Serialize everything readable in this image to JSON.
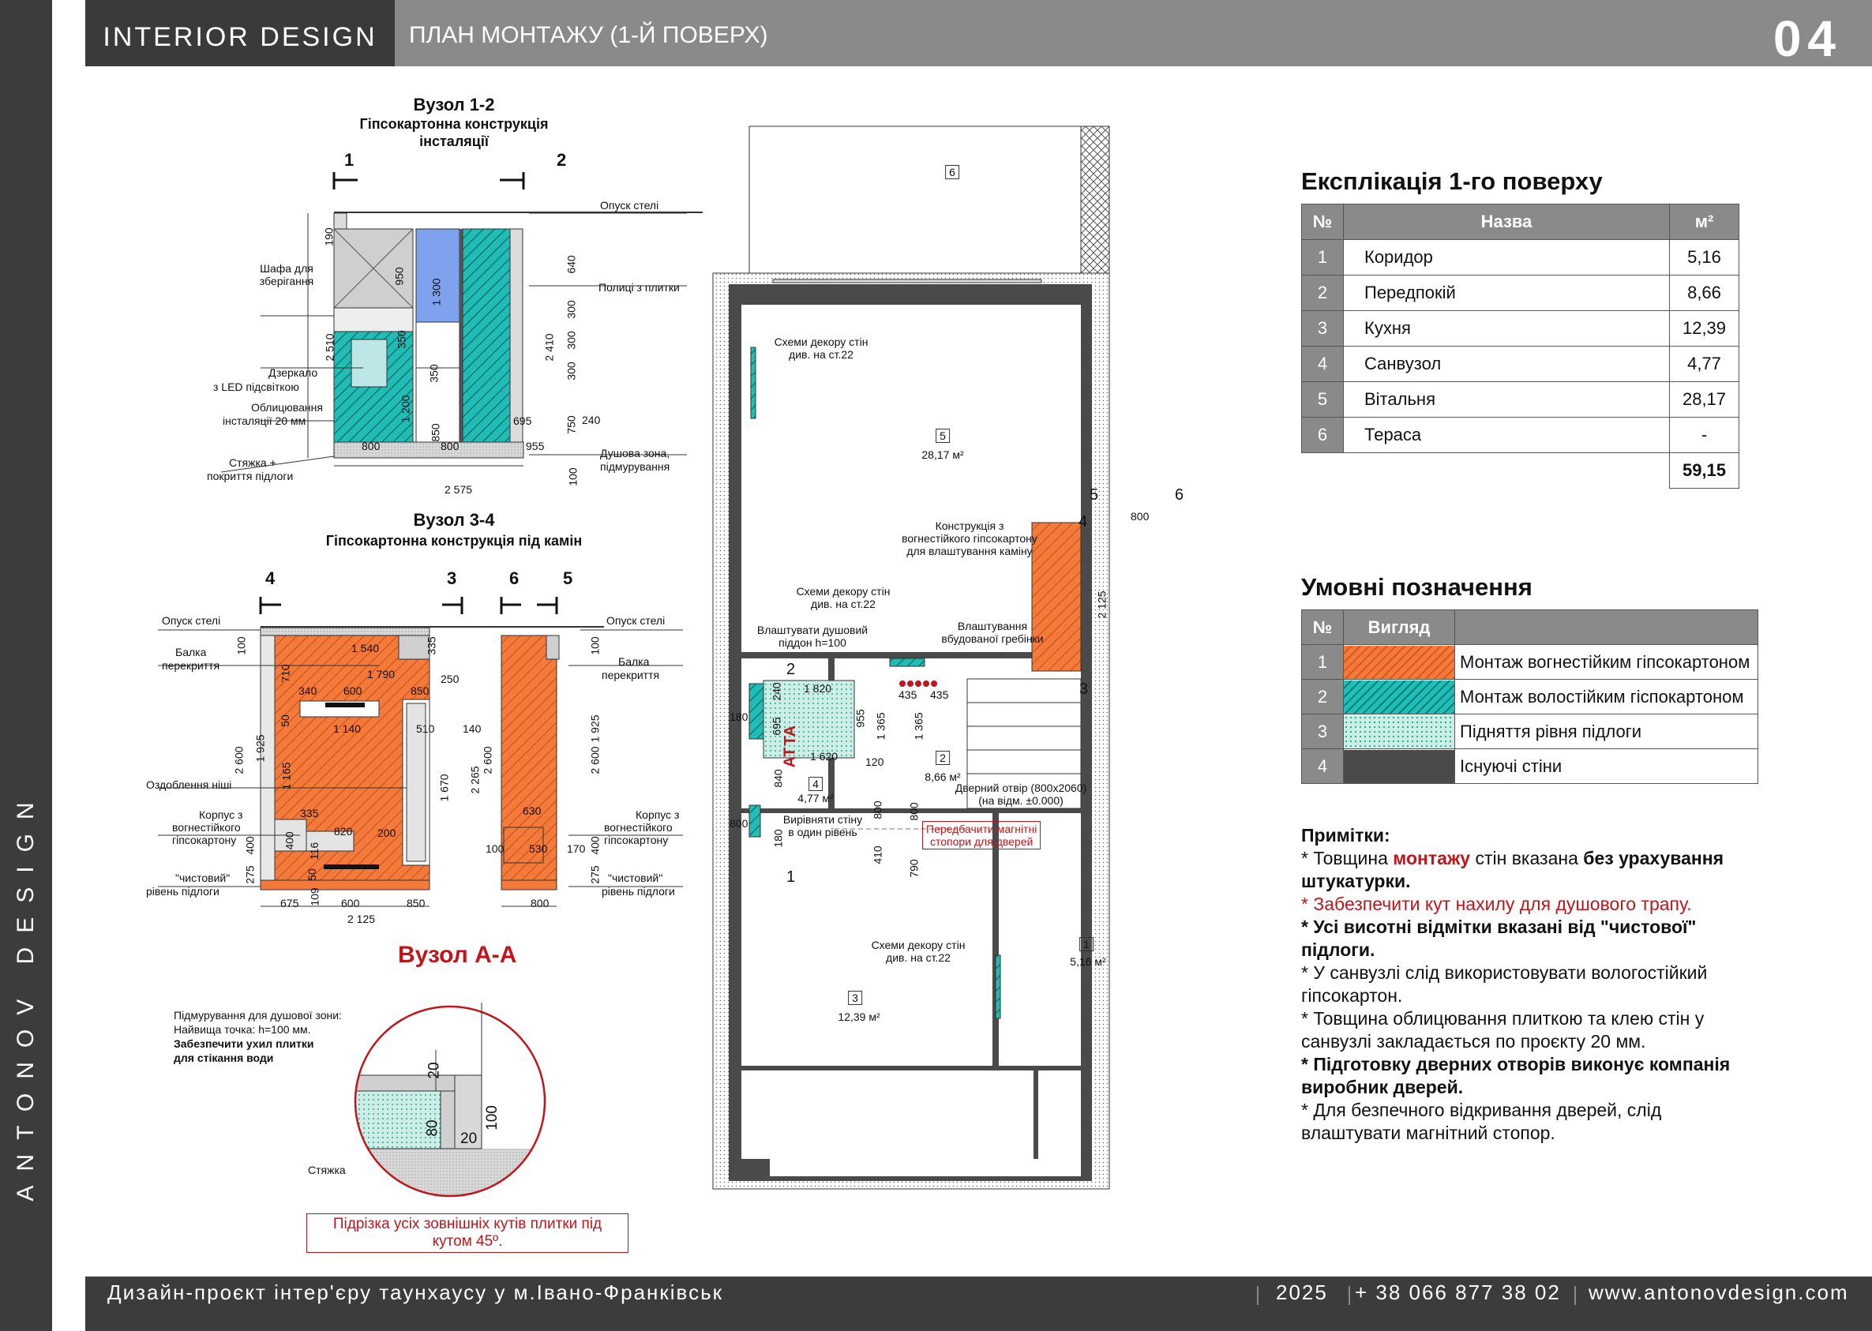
{
  "side_brand": "ANTONOV DESIGN",
  "header": {
    "brand": "INTERIOR DESIGN",
    "title": "ПЛАН МОНТАЖУ (1-Й ПОВЕРХ)",
    "page_number": "04"
  },
  "footer": {
    "project": "Дизайн-проєкт інтер'єру таунхаусу у м.Івано-Франківськ",
    "year": "2025",
    "phone": "+ 38 066 877 38 02",
    "website": "www.antonovdesign.com"
  },
  "explication": {
    "title": "Експлікація 1-го поверху",
    "headers": [
      "№",
      "Назва",
      "м²"
    ],
    "rows": [
      {
        "n": "1",
        "name": "Коридор",
        "area": "5,16"
      },
      {
        "n": "2",
        "name": "Передпокій",
        "area": "8,66"
      },
      {
        "n": "3",
        "name": "Кухня",
        "area": "12,39"
      },
      {
        "n": "4",
        "name": "Санвузол",
        "area": "4,77"
      },
      {
        "n": "5",
        "name": "Вітальня",
        "area": "28,17"
      },
      {
        "n": "6",
        "name": "Тераса",
        "area": "-"
      }
    ],
    "total": "59,15"
  },
  "legend": {
    "title": "Умовні позначення",
    "headers": [
      "№",
      "Вигляд"
    ],
    "rows": [
      {
        "n": "1",
        "label": "Монтаж вогнестійким гіпсокартоном",
        "swatch": "fire"
      },
      {
        "n": "2",
        "label": "Монтаж волостійким гіспокартоном",
        "swatch": "moist"
      },
      {
        "n": "3",
        "label": "Підняття рівня підлоги",
        "swatch": "floor"
      },
      {
        "n": "4",
        "label": "Існуючі стіни",
        "swatch": "exist"
      }
    ]
  },
  "notes": {
    "title": "Примітки:",
    "n1_a": "* Товщина ",
    "n1_b": "монтажу",
    "n1_c": " стін вказана ",
    "n1_d": "без урахування штукатурки.",
    "n2": "* Забезпечити кут нахилу для душового трапу.",
    "n3": "* Усі висотні відмітки вказані від \"чистової\" підлоги.",
    "n4": "* У санвузлі слід використовувати вологостійкий гіпсокартон.",
    "n5": "* Товщина облицювання плиткою та клею стін у санвузлі закладається по проєкту 20 мм.",
    "n6": "* Підготовку дверних отворів виконує компанія виробник дверей.",
    "n7": "* Для безпечного відкривання дверей, слід влаштувати магнітний стопор."
  },
  "node12": {
    "title": "Вузол 1-2",
    "subtitle1": "Гіпсокартонна конструкція",
    "subtitle2": "інсталяції",
    "mark1": "1",
    "mark2": "2",
    "l_cabinet": "Шафа для зберігання",
    "l_mirror1": "Дзеркало",
    "l_mirror2": "з LED підсвіткою",
    "l_cladding1": "Облицювання",
    "l_cladding2": "інсталяції 20 мм",
    "l_screed1": "Стяжка +",
    "l_screed2": "покриття підлоги",
    "r_ceiling": "Опуск стелі",
    "r_shelves": "Полиці з плитки",
    "r_shower1": "Душова зона,",
    "r_shower2": "підмурування",
    "dims": [
      "190",
      "950",
      "1 300",
      "350",
      "2 510",
      "350",
      "1 200",
      "850",
      "800",
      "800",
      "695",
      "955",
      "2 410",
      "640",
      "300",
      "300",
      "300",
      "750",
      "240",
      "100",
      "2 575"
    ]
  },
  "node34": {
    "title": "Вузол 3-4",
    "subtitle": "Гіпсокартонна конструкція під камін",
    "m4": "4",
    "m3": "3",
    "m6": "6",
    "m5": "5",
    "l_ceiling": "Опуск стелі",
    "l_beam1": "Балка",
    "l_beam2": "перекриття",
    "l_niche": "Оздоблення ніші",
    "l_body1": "Корпус з",
    "l_body2": "вогнестійкого",
    "l_body3": "гіпсокартону",
    "l_floor1": "\"чистовий\"",
    "l_floor2": "рівень підлоги",
    "dims": [
      "1 540",
      "335",
      "1 790",
      "250",
      "340",
      "600",
      "850",
      "1 140",
      "510",
      "140",
      "335",
      "820",
      "200",
      "1 670",
      "400",
      "116",
      "50",
      "109",
      "675",
      "600",
      "850",
      "2 125",
      "100",
      "710",
      "50",
      "1 165",
      "1 925",
      "2 600",
      "400",
      "275",
      "2 265",
      "2 600",
      "630",
      "530",
      "100",
      "170",
      "1 925",
      "2 600",
      "100",
      "400",
      "275",
      "800"
    ]
  },
  "nodeAA": {
    "title": "Вузол А-А",
    "t1": "Підмурування для душової зони:",
    "t2": "Найвища точка: h=100 мм.",
    "t3": "Забезпечити ухил плитки",
    "t4": "для стікання води",
    "screed": "Стяжка",
    "d20a": "20",
    "d80": "80",
    "d20b": "20",
    "d100": "100",
    "note": "Підрізка усіх зовнішніх кутів плитки під кутом 45º."
  },
  "plan": {
    "r6": "6",
    "r5": "5",
    "r5_area": "28,17 м²",
    "r4": "4",
    "r4_area": "4,77 м²",
    "r3": "3",
    "r3_area": "12,39 м²",
    "r2": "2",
    "r2_area": "8,66 м²",
    "r1": "1",
    "r1_area": "5,16 м²",
    "decor1a": "Схеми декору стін",
    "decor1b": "див. на ст.22",
    "decor2a": "Схеми декору стін",
    "decor2b": "див. на ст.22",
    "decor3a": "Схеми декору стін",
    "decor3b": "див. на ст.22",
    "fire_a": "Конструкція з",
    "fire_b": "вогнестійкого гіпсокартону",
    "fire_c": "для влаштування каміну",
    "tray_a": "Влаштувати душовий",
    "tray_b": "піддон h=100",
    "comb_a": "Влаштування",
    "comb_b": "вбудованої гребінки",
    "align_a": "Вирівняти стіну",
    "align_b": "в один рівень",
    "door_a": "Дверний отвір (800х2060)",
    "door_b": "(на відм. ±0.000)",
    "stop_a": "Передбачити магнітні",
    "stop_b": "стопори для дверей",
    "at": "АТ",
    "ta": "ТА",
    "dims": [
      "800",
      "2 125",
      "240",
      "1 820",
      "695",
      "955",
      "180",
      "1 365",
      "1 365",
      "435",
      "435",
      "1 620",
      "120",
      "840",
      "800",
      "800",
      "180",
      "800",
      "410",
      "790"
    ],
    "marks": [
      "5",
      "6",
      "4",
      "3",
      "2",
      "1"
    ]
  }
}
